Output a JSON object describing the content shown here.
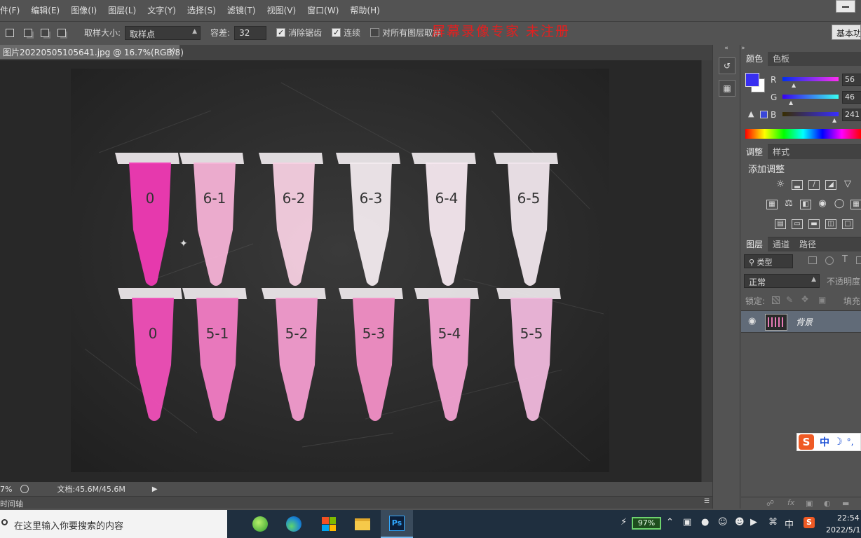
{
  "menu": [
    "件(F)",
    "编辑(E)",
    "图像(I)",
    "图层(L)",
    "文字(Y)",
    "选择(S)",
    "滤镜(T)",
    "视图(V)",
    "窗口(W)",
    "帮助(H)"
  ],
  "options": {
    "sample_size_label": "取样大小:",
    "sample_size_value": "取样点",
    "tolerance_label": "容差:",
    "tolerance_value": "32",
    "antialias_label": "消除锯齿",
    "contiguous_label": "连续",
    "all_layers_label": "对所有图层取样",
    "workspace_label": "基本功"
  },
  "watermark": "屏幕录像专家  未注册",
  "document": {
    "tab_title": "图片20220505105641.jpg @ 16.7%(RGB/8)",
    "tab_close": "×"
  },
  "tubes_top": [
    "0",
    "6-1",
    "6-2",
    "6-3",
    "6-4",
    "6-5"
  ],
  "tubes_bottom": [
    "0",
    "5-1",
    "5-2",
    "5-3",
    "5-4",
    "5-5"
  ],
  "status": {
    "zoom": "7%",
    "doc_info": "文档:45.6M/45.6M",
    "timeline_label": "时间轴"
  },
  "color_panel": {
    "tab_color": "颜色",
    "tab_swatches": "色板",
    "r_label": "R",
    "g_label": "G",
    "b_label": "B",
    "r_value": "56",
    "g_value": "46",
    "b_value": "241",
    "foreground_color": "#382ef1"
  },
  "adjust_panel": {
    "tab_adjust": "调整",
    "tab_styles": "样式",
    "heading": "添加调整"
  },
  "layers_panel": {
    "tab_layers": "图层",
    "tab_channels": "通道",
    "tab_paths": "路径",
    "filter_kind": "类型",
    "blend_mode": "正常",
    "opacity_label": "不透明度",
    "lock_label": "锁定:",
    "fill_label": "填充",
    "layer_name": "背景"
  },
  "taskbar": {
    "search_placeholder": "在这里输入你要搜索的内容",
    "battery": "97%",
    "ime_indicator": "中",
    "time": "22:54",
    "date": "2022/5/1"
  },
  "ime": {
    "logo": "S",
    "mode": "中",
    "moon": "☽",
    "punct": "°,"
  }
}
